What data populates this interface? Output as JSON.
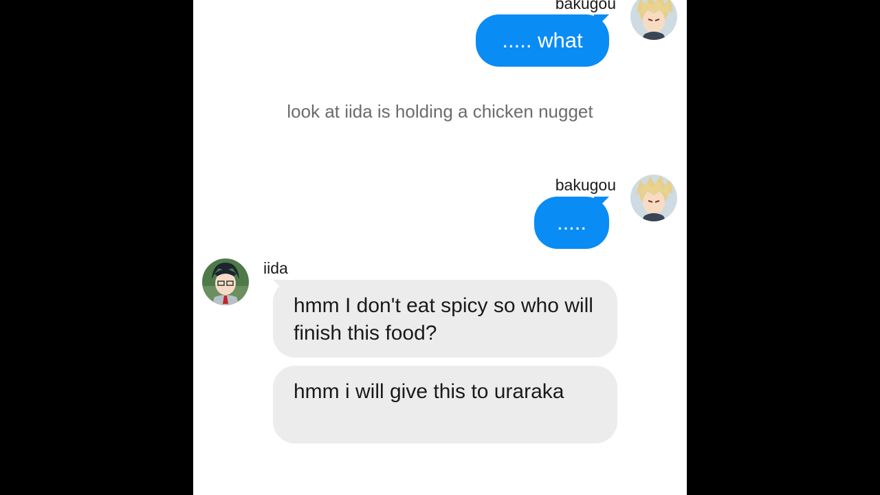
{
  "messages": [
    {
      "sender": "bakugou",
      "text": "..... what"
    },
    {
      "sender": "bakugou",
      "text": "....."
    },
    {
      "sender": "iida",
      "text": "hmm I don't eat spicy so who will finish this food?"
    },
    {
      "sender": "iida",
      "text": "hmm i will give this to uraraka"
    }
  ],
  "narration": "look at iida is holding a chicken nugget",
  "colors": {
    "outgoing_bubble": "#0a8cf5",
    "incoming_bubble": "#ececec",
    "chat_background": "#ffffff",
    "letterbox": "#000000"
  },
  "avatars": {
    "bakugou": "bakugou-avatar",
    "iida": "iida-avatar"
  }
}
